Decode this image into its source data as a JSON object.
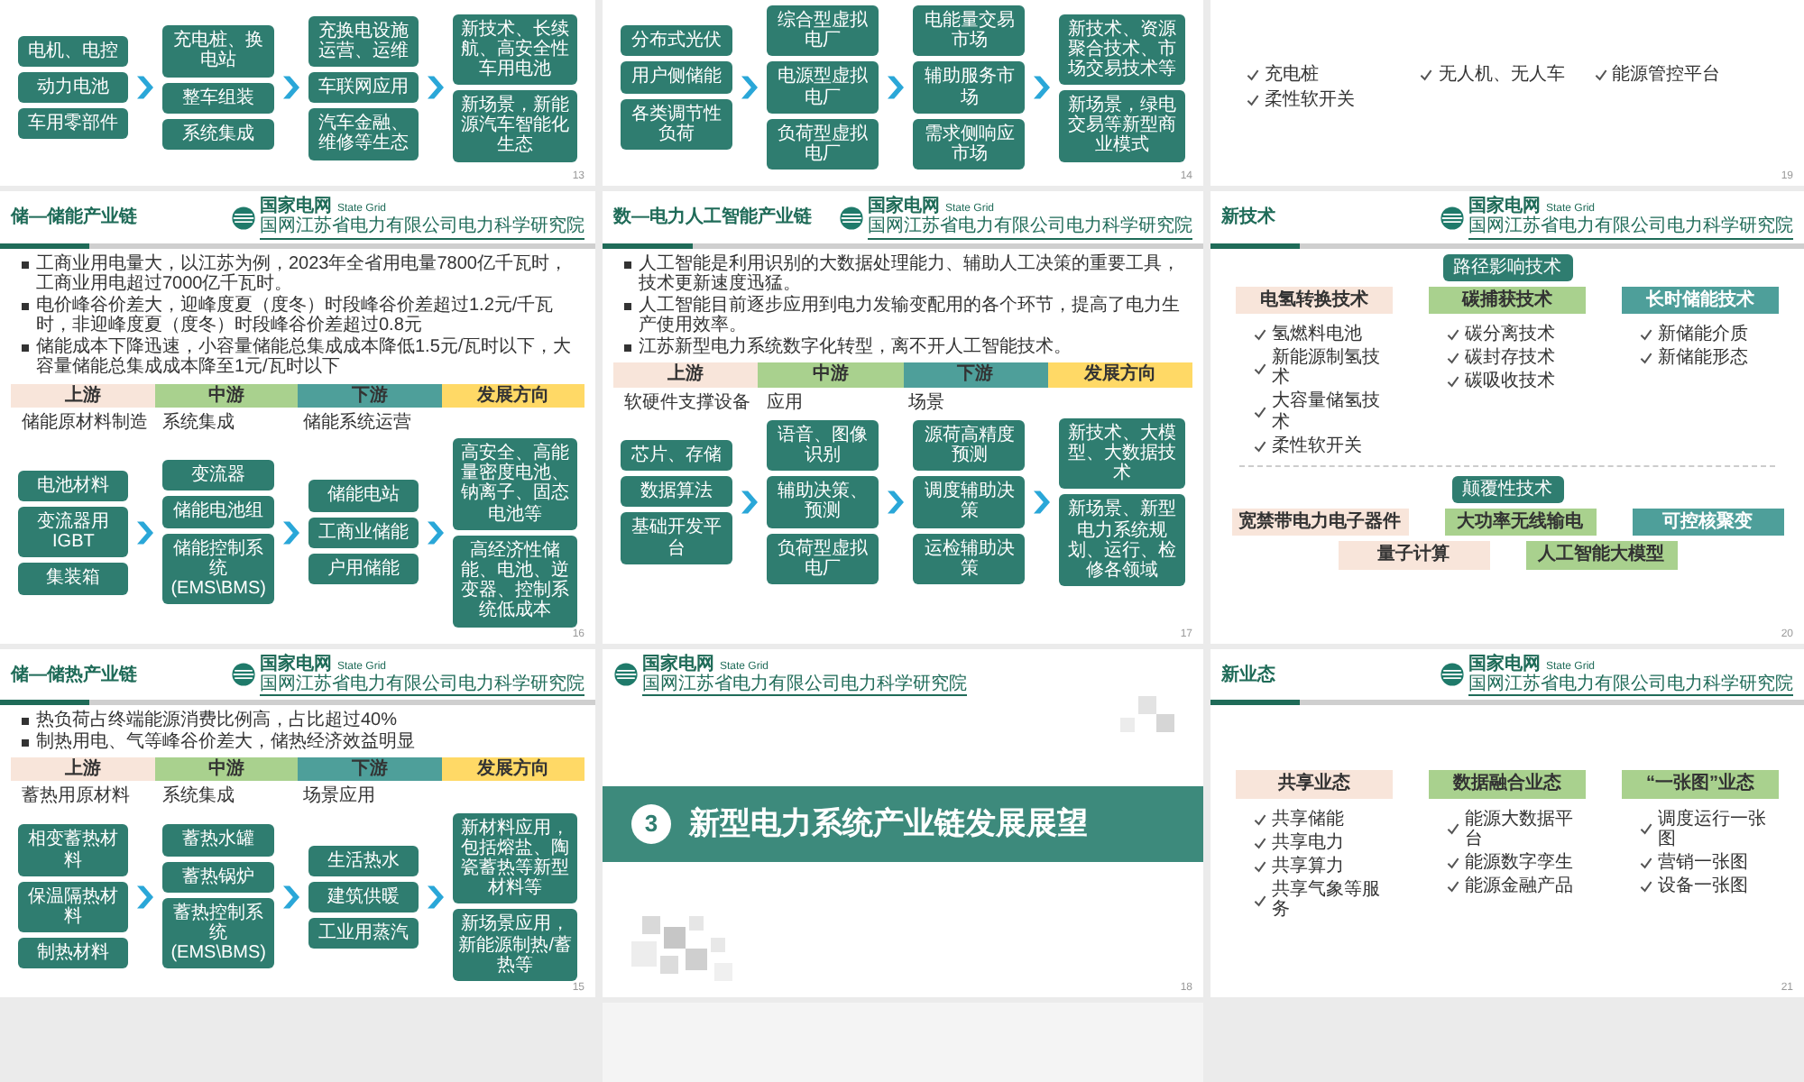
{
  "slides": [
    {
      "kind": "chain",
      "page": "13",
      "columns": [
        [
          "电机、电控",
          "动力电池",
          "车用零部件"
        ],
        [
          "充电桩、换电站",
          "整车组装",
          "系统集成"
        ],
        [
          "充换电设施运营、运维",
          "车联网应用",
          "汽车金融、维修等生态"
        ],
        [
          "新技术、长续航、高安全性车用电池",
          "新场景，新能源汽车智能化生态"
        ]
      ]
    },
    {
      "kind": "chain",
      "page": "14",
      "columns": [
        [
          "分布式光伏",
          "用户侧储能",
          "各类调节性负荷"
        ],
        [
          "综合型虚拟电厂",
          "电源型虚拟电厂",
          "负荷型虚拟电厂"
        ],
        [
          "电能量交易市场",
          "辅助服务市场",
          "需求侧响应市场"
        ],
        [
          "新技术、资源聚合技术、市场交易技术等",
          "新场景，绿电交易等新型商业模式"
        ]
      ]
    },
    {
      "kind": "checklist",
      "page": "19",
      "columns": [
        [
          "充电桩",
          "柔性软开关"
        ],
        [
          "无人机、无人车"
        ],
        [
          "能源管控平台"
        ]
      ]
    },
    {
      "kind": "chain",
      "title": "储—储能产业链",
      "page": "16",
      "logo": {
        "name": "国家电网",
        "english": "State Grid",
        "subtitle": "国网江苏省电力有限公司电力科学研究院"
      },
      "bullets": [
        "工商业用电量大，以江苏为例，2023年全省用电量7800亿千瓦时，工商业用电超过7000亿千瓦时。",
        "电价峰谷价差大，迎峰度夏（度冬）时段峰谷价差超过1.2元/千瓦时，非迎峰度夏（度冬）时段峰谷价差超过0.8元",
        "储能成本下降迅速，小容量储能总集成成本降低1.5元/瓦时以下，大容量储能总集成成本降至1元/瓦时以下"
      ],
      "stages": [
        {
          "label": "上游",
          "color": "#f8e5da"
        },
        {
          "label": "中游",
          "color": "#a9d18e"
        },
        {
          "label": "下游",
          "color": "#4e9f9a"
        },
        {
          "label": "发展方向",
          "color": "#ffd966"
        }
      ],
      "labels": [
        "储能原材料制造",
        "系统集成",
        "储能系统运营"
      ],
      "columns": [
        [
          "电池材料",
          "变流器用IGBT",
          "集装箱"
        ],
        [
          "变流器",
          "储能电池组",
          "储能控制系统(EMS\\BMS)"
        ],
        [
          "储能电站",
          "工商业储能",
          "户用储能"
        ],
        [
          "高安全、高能量密度电池、钠离子、固态电池等",
          "高经济性储能、电池、逆变器、控制系统低成本"
        ]
      ]
    },
    {
      "kind": "chain",
      "title": "数—电力人工智能产业链",
      "page": "17",
      "logo": {
        "name": "国家电网",
        "english": "State Grid",
        "subtitle": "国网江苏省电力有限公司电力科学研究院"
      },
      "bullets": [
        "人工智能是利用识别的大数据处理能力、辅助人工决策的重要工具，技术更新速度迅猛。",
        "人工智能目前逐步应用到电力发输变配用的各个环节，提高了电力生产使用效率。",
        "江苏新型电力系统数字化转型，离不开人工智能技术。"
      ],
      "stages": [
        {
          "label": "上游",
          "color": "#f8e5da"
        },
        {
          "label": "中游",
          "color": "#a9d18e"
        },
        {
          "label": "下游",
          "color": "#4e9f9a"
        },
        {
          "label": "发展方向",
          "color": "#ffd966"
        }
      ],
      "labels": [
        "软硬件支撑设备",
        "应用",
        "场景"
      ],
      "columns": [
        [
          "芯片、存储",
          "数据算法",
          "基础开发平台"
        ],
        [
          "语音、图像识别",
          "辅助决策、预测",
          "负荷型虚拟电厂"
        ],
        [
          "源荷高精度预测",
          "调度辅助决策",
          "运检辅助决策"
        ],
        [
          "新技术、大模型、大数据技术",
          "新场景、新型电力系统规划、运行、检修各领域"
        ]
      ]
    },
    {
      "kind": "tech",
      "title": "新技术",
      "page": "20",
      "logo": {
        "name": "国家电网",
        "english": "State Grid",
        "subtitle": "国网江苏省电力有限公司电力科学研究院"
      },
      "sections": [
        {
          "kind": "categorized",
          "badge": "路径影响技术",
          "categories": [
            {
              "label": "电氢转换技术",
              "color": "#f8e5da",
              "items": [
                "氢燃料电池",
                "新能源制氢技术",
                "大容量储氢技术",
                "柔性软开关"
              ]
            },
            {
              "label": "碳捕获技术",
              "color": "#a9d18e",
              "items": [
                "碳分离技术",
                "碳封存技术",
                "碳吸收技术"
              ]
            },
            {
              "label": "长时储能技术",
              "color": "#4e9f9a",
              "items": [
                "新储能介质",
                "新储能形态"
              ]
            }
          ]
        },
        {
          "kind": "tag_rows",
          "badge": "颠覆性技术",
          "rows": [
            [
              {
                "label": "宽禁带电力电子器件",
                "color": "#f8e5da"
              },
              {
                "label": "大功率无线输电",
                "color": "#a9d18e"
              },
              {
                "label": "可控核聚变",
                "color": "#4e9f9a"
              }
            ],
            [
              {
                "label": "量子计算",
                "color": "#f8e5da"
              },
              {
                "label": "人工智能大模型",
                "color": "#a9d18e"
              }
            ]
          ]
        }
      ]
    },
    {
      "kind": "chain",
      "title": "储—储热产业链",
      "page": "15",
      "logo": {
        "name": "国家电网",
        "english": "State Grid",
        "subtitle": "国网江苏省电力有限公司电力科学研究院"
      },
      "bullets": [
        "热负荷占终端能源消费比例高，占比超过40%",
        "制热用电、气等峰谷价差大，储热经济效益明显"
      ],
      "stages": [
        {
          "label": "上游",
          "color": "#f8e5da"
        },
        {
          "label": "中游",
          "color": "#a9d18e"
        },
        {
          "label": "下游",
          "color": "#4e9f9a"
        },
        {
          "label": "发展方向",
          "color": "#ffd966"
        }
      ],
      "labels": [
        "蓄热用原材料",
        "系统集成",
        "场景应用"
      ],
      "columns": [
        [
          "相变蓄热材料",
          "保温隔热材料",
          "制热材料"
        ],
        [
          "蓄热水罐",
          "蓄热锅炉",
          "蓄热控制系统(EMS\\BMS)"
        ],
        [
          "生活热水",
          "建筑供暖",
          "工业用蒸汽"
        ],
        [
          "新材料应用，包括熔盐、陶瓷蓄热等新型材料等",
          "新场景应用，新能源制热/蓄热等"
        ]
      ]
    },
    {
      "kind": "section_title",
      "page": "18",
      "logo": {
        "name": "国家电网",
        "english": "State Grid",
        "subtitle": "国网江苏省电力有限公司电力科学研究院"
      },
      "number": "3",
      "title": "新型电力系统产业链发展展望"
    },
    {
      "kind": "business",
      "title": "新业态",
      "page": "21",
      "logo": {
        "name": "国家电网",
        "english": "State Grid",
        "subtitle": "国网江苏省电力有限公司电力科学研究院"
      },
      "sections": [
        {
          "kind": "categorized",
          "categories": [
            {
              "label": "共享业态",
              "color": "#f8e5da",
              "items": [
                "共享储能",
                "共享电力",
                "共享算力",
                "共享气象等服务"
              ]
            },
            {
              "label": "数据融合业态",
              "color": "#a9d18e",
              "items": [
                "能源大数据平台",
                "能源数字孪生",
                "能源金融产品"
              ]
            },
            {
              "label": "“一张图”业态",
              "color": "#a9d18e",
              "items": [
                "调度运行一张图",
                "营销一张图",
                "设备一张图"
              ]
            }
          ]
        }
      ]
    }
  ]
}
